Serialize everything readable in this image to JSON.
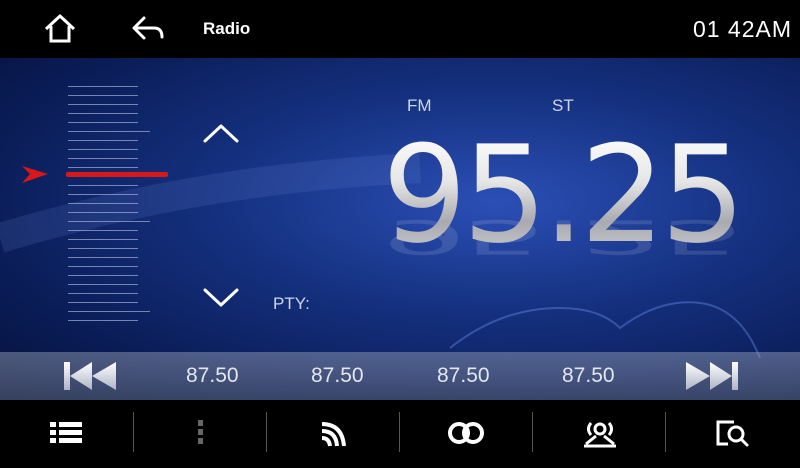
{
  "header": {
    "title": "Radio",
    "time": "01 42AM",
    "home_icon": "home-icon",
    "back_icon": "back-arrow-icon"
  },
  "tuner": {
    "band": "FM",
    "stereo": "ST",
    "frequency": "95.25",
    "pty_label": "PTY:"
  },
  "presets": [
    "87.50",
    "87.50",
    "87.50",
    "87.50"
  ],
  "bottom_bar": {
    "icons": [
      "list-icon",
      "more-dots-icon",
      "signal-icon",
      "loop-icon",
      "radio-scan-icon",
      "search-icon"
    ]
  },
  "colors": {
    "needle": "#d81818",
    "accent_blue": "#14307e",
    "text_light": "#cfd6ea"
  }
}
